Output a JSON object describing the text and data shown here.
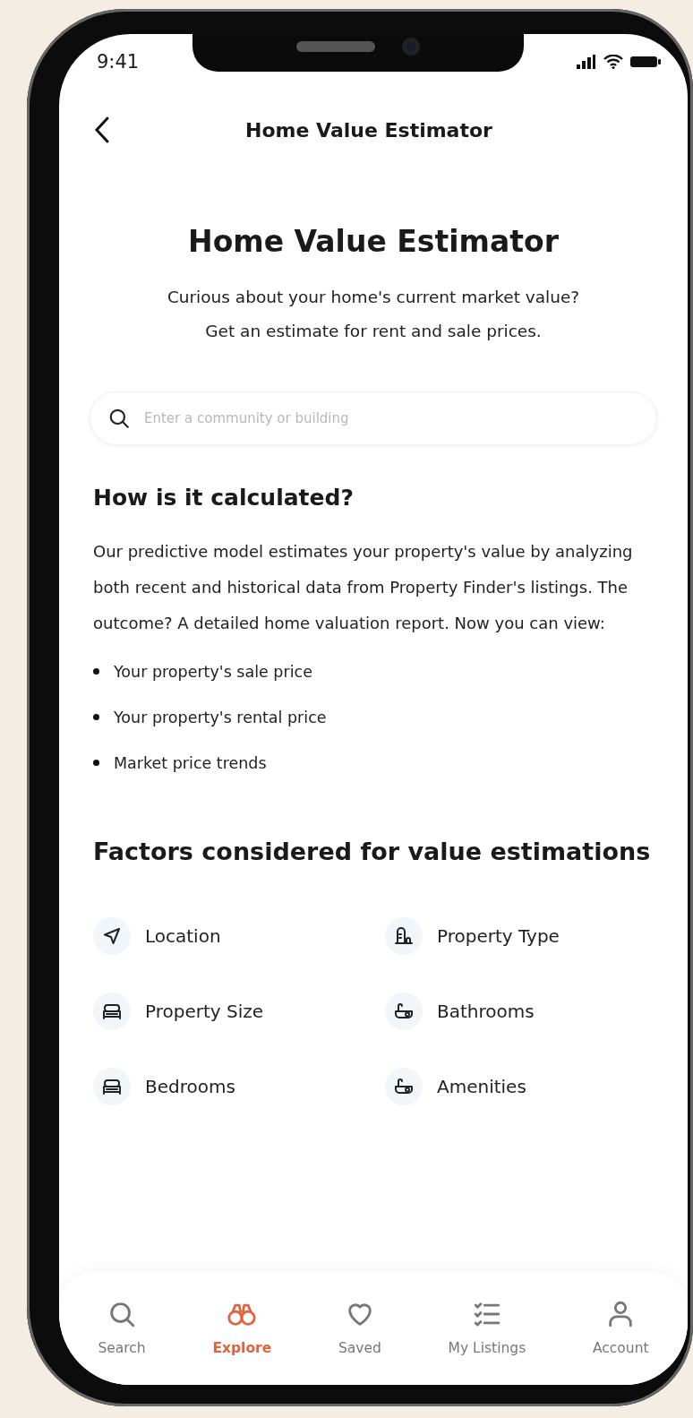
{
  "status_bar": {
    "time": "9:41"
  },
  "header": {
    "title": "Home Value Estimator"
  },
  "hero": {
    "title": "Home Value Estimator",
    "subtitle": "Curious about your home's current market value? Get an estimate for rent and sale prices."
  },
  "search": {
    "placeholder": "Enter a community or building"
  },
  "calculation": {
    "heading": "How is it calculated?",
    "body": "Our predictive model estimates your property's value by analyzing both recent and historical data from Property Finder's listings. The outcome? A detailed home valuation report. Now you can view:",
    "bullets": [
      "Your property's sale price",
      "Your property's rental price",
      "Market price trends"
    ]
  },
  "factors": {
    "heading": "Factors considered for value estimations",
    "items": [
      {
        "label": "Location",
        "kind": "location"
      },
      {
        "label": "Property Type",
        "kind": "building"
      },
      {
        "label": "Property Size",
        "kind": "sofa"
      },
      {
        "label": "Bathrooms",
        "kind": "bath"
      },
      {
        "label": "Bedrooms",
        "kind": "sofa"
      },
      {
        "label": "Amenities",
        "kind": "bath"
      }
    ]
  },
  "tab_bar": [
    {
      "label": "Search",
      "kind": "search",
      "selected": false
    },
    {
      "label": "Explore",
      "kind": "binoculars",
      "selected": true
    },
    {
      "label": "Saved",
      "kind": "heart",
      "selected": false
    },
    {
      "label": "My Listings",
      "kind": "checklist",
      "selected": false
    },
    {
      "label": "Account",
      "kind": "person",
      "selected": false
    }
  ]
}
